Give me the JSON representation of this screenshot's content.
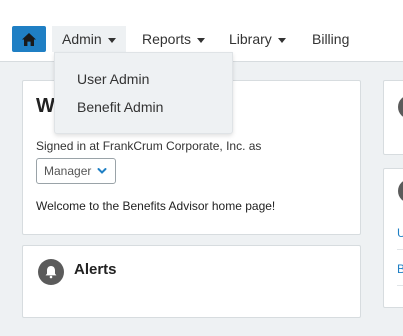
{
  "nav": {
    "home_icon": "home-icon",
    "items": [
      {
        "label": "Admin",
        "has_menu": true,
        "open": true
      },
      {
        "label": "Reports",
        "has_menu": true
      },
      {
        "label": "Library",
        "has_menu": true
      },
      {
        "label": "Billing",
        "has_menu": false
      }
    ],
    "accent_color": "#1f7fc4"
  },
  "admin_menu": {
    "items": [
      "User Admin",
      "Benefit Admin"
    ]
  },
  "welcome_panel": {
    "heading": "W",
    "signed_in_text": "Signed in at FrankCrum Corporate, Inc. as",
    "role_selected": "Manager",
    "message": "Welcome to the Benefits Advisor home page!"
  },
  "alerts_panel": {
    "icon": "bell-icon",
    "title": "Alerts"
  },
  "right_panel": {
    "links": [
      "U",
      "B"
    ]
  }
}
